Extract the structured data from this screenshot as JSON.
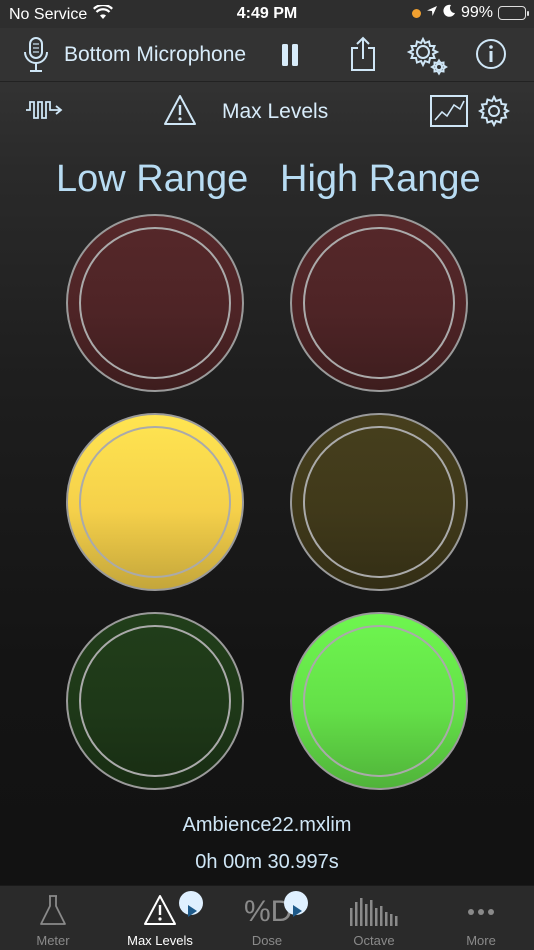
{
  "status": {
    "carrier": "No Service",
    "time": "4:49 PM",
    "battery": "99%",
    "icons": [
      "wifi-icon",
      "location-icon",
      "moon-icon",
      "battery-icon"
    ]
  },
  "toolbar": {
    "microphone_label": "Bottom Microphone",
    "icons": [
      "microphone-icon",
      "pause-icon",
      "share-icon",
      "settings-gear-icon",
      "info-icon"
    ]
  },
  "section": {
    "title": "Max Levels",
    "icons": [
      "waveform-icon",
      "warning-icon",
      "chart-icon",
      "gear-icon"
    ]
  },
  "ranges": {
    "low": "Low Range",
    "high": "High Range"
  },
  "lights": {
    "low": {
      "red": {
        "state": "off",
        "color": "#4e2426"
      },
      "yellow": {
        "state": "on",
        "color": "#f5d04a"
      },
      "green": {
        "state": "off",
        "color": "#1e3818"
      }
    },
    "high": {
      "red": {
        "state": "off",
        "color": "#4e2426"
      },
      "yellow": {
        "state": "off",
        "color": "#40391a"
      },
      "green": {
        "state": "on",
        "color": "#64e048"
      }
    }
  },
  "recording": {
    "file_name": "Ambience22.mxlim",
    "elapsed": "0h 00m 30.997s"
  },
  "tabs": [
    {
      "label": "Meter",
      "icon": "flask-icon",
      "active": false
    },
    {
      "label": "Max Levels",
      "icon": "warning-icon",
      "active": true,
      "badge": "play-icon"
    },
    {
      "label": "Dose",
      "icon": "percent-d-icon",
      "active": false,
      "badge": "play-icon"
    },
    {
      "label": "Octave",
      "icon": "octave-bars-icon",
      "active": false
    },
    {
      "label": "More",
      "icon": "more-dots-icon",
      "active": false
    }
  ]
}
